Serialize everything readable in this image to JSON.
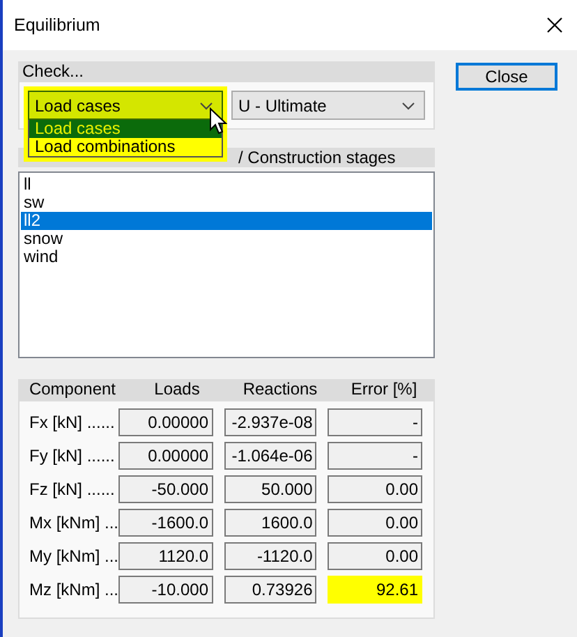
{
  "window": {
    "title": "Equilibrium"
  },
  "check": {
    "title": "Check...",
    "type_combo": {
      "value": "Load cases",
      "open": true,
      "highlighted": true,
      "options": [
        {
          "label": "Load cases",
          "selected": true
        },
        {
          "label": "Load combinations",
          "selected": false
        }
      ]
    },
    "limit_combo": {
      "value": "U - Ultimate"
    }
  },
  "close_button": "Close",
  "cases": {
    "title": "/ Construction stages",
    "items": [
      {
        "label": "ll",
        "selected": false
      },
      {
        "label": "sw",
        "selected": false
      },
      {
        "label": "ll2",
        "selected": true
      },
      {
        "label": "snow",
        "selected": false
      },
      {
        "label": "wind",
        "selected": false
      }
    ]
  },
  "results": {
    "columns": [
      "Component",
      "Loads",
      "Reactions",
      "Error [%]"
    ],
    "rows": [
      {
        "component": "Fx [kN] ......",
        "loads": "0.00000",
        "reactions": "-2.937e-08",
        "error": "-",
        "highlighted": false
      },
      {
        "component": "Fy [kN] ......",
        "loads": "0.00000",
        "reactions": "-1.064e-06",
        "error": "-",
        "highlighted": false
      },
      {
        "component": "Fz [kN] ......",
        "loads": "-50.000",
        "reactions": "50.000",
        "error": "0.00",
        "highlighted": false
      },
      {
        "component": "Mx [kNm] ...",
        "loads": "-1600.0",
        "reactions": "1600.0",
        "error": "0.00",
        "highlighted": false
      },
      {
        "component": "My [kNm] ...",
        "loads": "1120.0",
        "reactions": "-1120.0",
        "error": "0.00",
        "highlighted": false
      },
      {
        "component": "Mz [kNm] ...",
        "loads": "-10.000",
        "reactions": "0.73926",
        "error": "92.61",
        "highlighted": true
      }
    ]
  }
}
